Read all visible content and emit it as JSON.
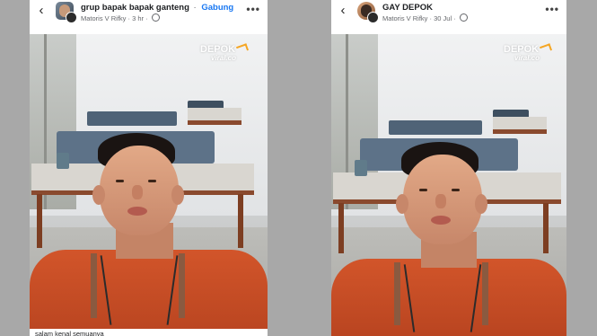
{
  "left_post": {
    "group_name": "grup bapak bapak ganteng",
    "separator": "·",
    "join_label": "Gabung",
    "author": "Matoris V Rifky",
    "time": "3 hr",
    "more": "•••",
    "back": "‹",
    "caption": "salam kenal semuanya",
    "watermark_main": "DEPOK",
    "watermark_sub": "viral.co"
  },
  "right_post": {
    "group_name": "GAY DEPOK",
    "author": "Matoris V Rifky",
    "time": "30 Jul",
    "more": "•••",
    "back": "‹",
    "watermark_main": "DEPOK",
    "watermark_sub": "viral.co"
  },
  "meta_separator": "·",
  "colors": {
    "link": "#1877f2",
    "shirt": "#c84a24",
    "background": "#a8a8a8"
  },
  "icons": [
    "back-arrow-icon",
    "globe-icon",
    "more-options-icon"
  ]
}
